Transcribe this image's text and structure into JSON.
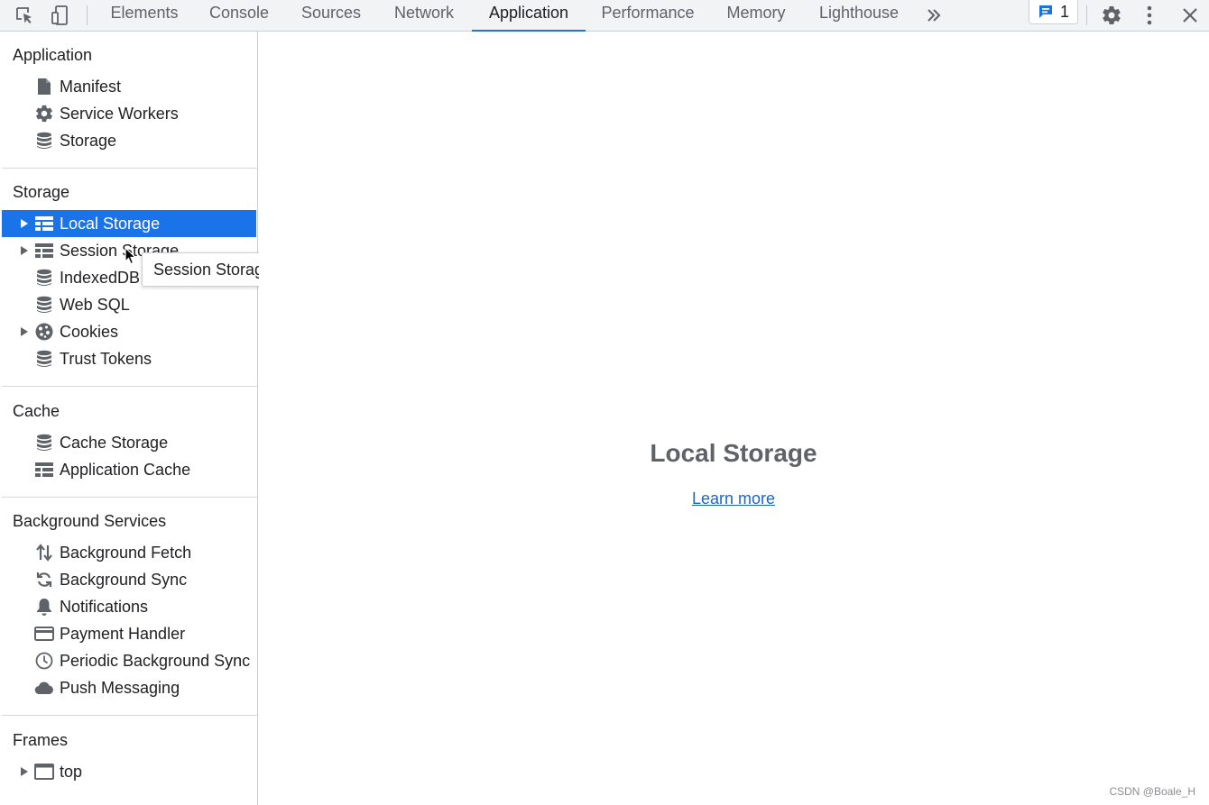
{
  "toolbar": {
    "tabs": [
      "Elements",
      "Console",
      "Sources",
      "Network",
      "Application",
      "Performance",
      "Memory",
      "Lighthouse"
    ],
    "active_tab": "Application",
    "issues_count": "1",
    "icons": [
      "inspect-element-icon",
      "device-toolbar-icon",
      "more-tabs-icon",
      "issues-icon",
      "gear-icon",
      "kebab-menu-icon",
      "close-icon"
    ]
  },
  "sidebar": {
    "sections": {
      "application": "Application",
      "storage": "Storage",
      "cache": "Cache",
      "background": "Background Services",
      "frames": "Frames"
    },
    "application_items": [
      {
        "label": "Manifest",
        "icon": "file-icon"
      },
      {
        "label": "Service Workers",
        "icon": "gear-icon"
      },
      {
        "label": "Storage",
        "icon": "database-icon"
      }
    ],
    "storage_items": [
      {
        "label": "Local Storage",
        "icon": "table-icon",
        "selected": true
      },
      {
        "label": "Session Storage",
        "icon": "table-icon"
      },
      {
        "label": "IndexedDB",
        "icon": "database-icon"
      },
      {
        "label": "Web SQL",
        "icon": "database-icon"
      },
      {
        "label": "Cookies",
        "icon": "cookie-icon"
      },
      {
        "label": "Trust Tokens",
        "icon": "database-icon"
      }
    ],
    "cache_items": [
      {
        "label": "Cache Storage",
        "icon": "database-icon"
      },
      {
        "label": "Application Cache",
        "icon": "table-icon"
      }
    ],
    "background_items": [
      {
        "label": "Background Fetch",
        "icon": "up-down-arrows-icon"
      },
      {
        "label": "Background Sync",
        "icon": "sync-icon"
      },
      {
        "label": "Notifications",
        "icon": "bell-icon"
      },
      {
        "label": "Payment Handler",
        "icon": "credit-card-icon"
      },
      {
        "label": "Periodic Background Sync",
        "icon": "clock-icon"
      },
      {
        "label": "Push Messaging",
        "icon": "cloud-icon"
      }
    ],
    "frames_items": [
      {
        "label": "top",
        "icon": "window-frame-icon"
      }
    ]
  },
  "tooltip": {
    "text": "Session Storage"
  },
  "main": {
    "title": "Local Storage",
    "link": "Learn more"
  },
  "watermark": "CSDN @Boale_H",
  "colors": {
    "accent": "#1a73e8",
    "toolbar_bg": "#f1f3f4",
    "icon_gray": "#5f6368",
    "link": "#1a65c7"
  }
}
